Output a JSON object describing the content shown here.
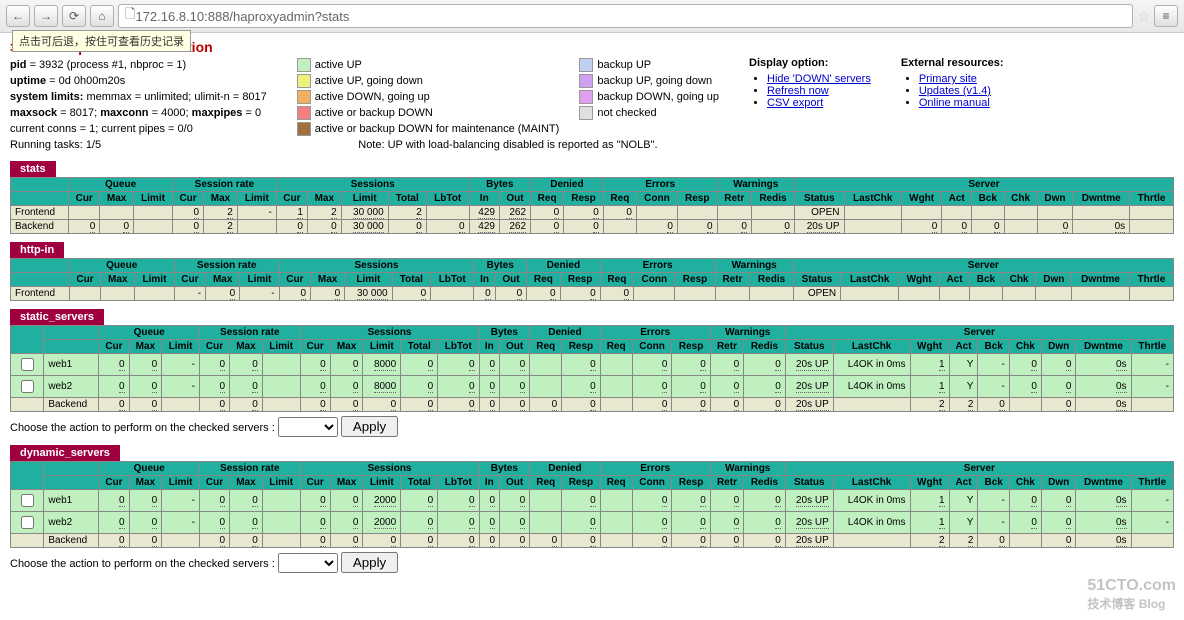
{
  "browser": {
    "url": "172.16.8.10:888/haproxyadmin?stats",
    "tooltip": "点击可后退，按住可查看历史记录"
  },
  "title": "> General process information",
  "process": {
    "pid_label": "pid",
    "pid_val": "= 3932 (process #1, nbproc = 1)",
    "uptime_label": "uptime",
    "uptime_val": "= 0d 0h00m20s",
    "limits_label": "system limits:",
    "limits_val": "memmax = unlimited; ulimit-n = 8017",
    "maxsock_label": "maxsock",
    "maxsock_val": "= 8017;",
    "maxconn_label": "maxconn",
    "maxconn_val": "= 4000;",
    "maxpipes_label": "maxpipes",
    "maxpipes_val": "= 0",
    "conns": "current conns = 1; current pipes = 0/0",
    "tasks": "Running tasks: 1/5"
  },
  "legend": {
    "c1": [
      [
        "#c0f0c0",
        "active UP"
      ],
      [
        "#f0f080",
        "active UP, going down"
      ],
      [
        "#f0b060",
        "active DOWN, going up"
      ],
      [
        "#f08080",
        "active or backup DOWN"
      ],
      [
        "#a07040",
        "active or backup DOWN for maintenance (MAINT)"
      ]
    ],
    "c2": [
      [
        "#c0d0f0",
        "backup UP"
      ],
      [
        "#d0a0f0",
        "backup UP, going down"
      ],
      [
        "#e0a0f0",
        "backup DOWN, going up"
      ],
      [
        "#e0e0e0",
        "not checked"
      ]
    ],
    "note": "Note: UP with load-balancing disabled is reported as \"NOLB\"."
  },
  "display_option": {
    "title": "Display option:",
    "items": [
      "Hide 'DOWN' servers",
      "Refresh now",
      "CSV export"
    ]
  },
  "external": {
    "title": "External resources:",
    "items": [
      "Primary site",
      "Updates (v1.4)",
      "Online manual"
    ]
  },
  "header_groups": [
    "",
    "Queue",
    "Session rate",
    "Sessions",
    "Bytes",
    "Denied",
    "Errors",
    "Warnings",
    "Server"
  ],
  "header_cols": [
    "",
    "Cur",
    "Max",
    "Limit",
    "Cur",
    "Max",
    "Limit",
    "Cur",
    "Max",
    "Limit",
    "Total",
    "LbTot",
    "In",
    "Out",
    "Req",
    "Resp",
    "Req",
    "Conn",
    "Resp",
    "Retr",
    "Redis",
    "Status",
    "LastChk",
    "Wght",
    "Act",
    "Bck",
    "Chk",
    "Dwn",
    "Dwntme",
    "Thrtle"
  ],
  "action": {
    "label": "Choose the action to perform on the checked servers :",
    "apply": "Apply"
  },
  "proxies": [
    {
      "name": "stats",
      "rows": [
        {
          "cls": "",
          "c": [
            "Frontend",
            "",
            "",
            "",
            "0",
            "2",
            "-",
            "1",
            "2",
            "30 000",
            "2",
            "",
            "429",
            "262",
            "0",
            "0",
            "0",
            "",
            "",
            "",
            "",
            "OPEN",
            "",
            "",
            "",
            "",
            "",
            "",
            "",
            ""
          ]
        },
        {
          "cls": "backend",
          "c": [
            "Backend",
            "0",
            "0",
            "",
            "0",
            "2",
            "",
            "0",
            "0",
            "30 000",
            "0",
            "0",
            "429",
            "262",
            "0",
            "0",
            "",
            "0",
            "0",
            "0",
            "0",
            "20s UP",
            "",
            "0",
            "0",
            "0",
            "",
            "0",
            "0s",
            ""
          ]
        }
      ],
      "hasAction": false,
      "hasChk": false
    },
    {
      "name": "http-in",
      "rows": [
        {
          "cls": "",
          "c": [
            "Frontend",
            "",
            "",
            "",
            "-",
            "0",
            "-",
            "0",
            "0",
            "30 000",
            "0",
            "",
            "0",
            "0",
            "0",
            "0",
            "0",
            "",
            "",
            "",
            "",
            "OPEN",
            "",
            "",
            "",
            "",
            "",
            "",
            "",
            ""
          ]
        }
      ],
      "hasAction": false,
      "hasChk": false
    },
    {
      "name": "static_servers",
      "rows": [
        {
          "cls": "up",
          "c": [
            "web1",
            "0",
            "0",
            "-",
            "0",
            "0",
            "",
            "0",
            "0",
            "8000",
            "0",
            "0",
            "0",
            "0",
            "",
            "0",
            "",
            "0",
            "0",
            "0",
            "0",
            "20s UP",
            "L4OK in 0ms",
            "1",
            "Y",
            "-",
            "0",
            "0",
            "0s",
            "-"
          ]
        },
        {
          "cls": "up",
          "c": [
            "web2",
            "0",
            "0",
            "-",
            "0",
            "0",
            "",
            "0",
            "0",
            "8000",
            "0",
            "0",
            "0",
            "0",
            "",
            "0",
            "",
            "0",
            "0",
            "0",
            "0",
            "20s UP",
            "L4OK in 0ms",
            "1",
            "Y",
            "-",
            "0",
            "0",
            "0s",
            "-"
          ]
        },
        {
          "cls": "backend",
          "c": [
            "Backend",
            "0",
            "0",
            "",
            "0",
            "0",
            "",
            "0",
            "0",
            "0",
            "0",
            "0",
            "0",
            "0",
            "0",
            "0",
            "",
            "0",
            "0",
            "0",
            "0",
            "20s UP",
            "",
            "2",
            "2",
            "0",
            "",
            "0",
            "0s",
            ""
          ]
        }
      ],
      "hasAction": true,
      "hasChk": true
    },
    {
      "name": "dynamic_servers",
      "rows": [
        {
          "cls": "up",
          "c": [
            "web1",
            "0",
            "0",
            "-",
            "0",
            "0",
            "",
            "0",
            "0",
            "2000",
            "0",
            "0",
            "0",
            "0",
            "",
            "0",
            "",
            "0",
            "0",
            "0",
            "0",
            "20s UP",
            "L4OK in 0ms",
            "1",
            "Y",
            "-",
            "0",
            "0",
            "0s",
            "-"
          ]
        },
        {
          "cls": "up",
          "c": [
            "web2",
            "0",
            "0",
            "-",
            "0",
            "0",
            "",
            "0",
            "0",
            "2000",
            "0",
            "0",
            "0",
            "0",
            "",
            "0",
            "",
            "0",
            "0",
            "0",
            "0",
            "20s UP",
            "L4OK in 0ms",
            "1",
            "Y",
            "-",
            "0",
            "0",
            "0s",
            "-"
          ]
        },
        {
          "cls": "backend",
          "c": [
            "Backend",
            "0",
            "0",
            "",
            "0",
            "0",
            "",
            "0",
            "0",
            "0",
            "0",
            "0",
            "0",
            "0",
            "0",
            "0",
            "",
            "0",
            "0",
            "0",
            "0",
            "20s UP",
            "",
            "2",
            "2",
            "0",
            "",
            "0",
            "0s",
            ""
          ]
        }
      ],
      "hasAction": true,
      "hasChk": true
    }
  ],
  "watermark": {
    "l1": "51CTO.com",
    "l2": "技术博客 Blog"
  }
}
